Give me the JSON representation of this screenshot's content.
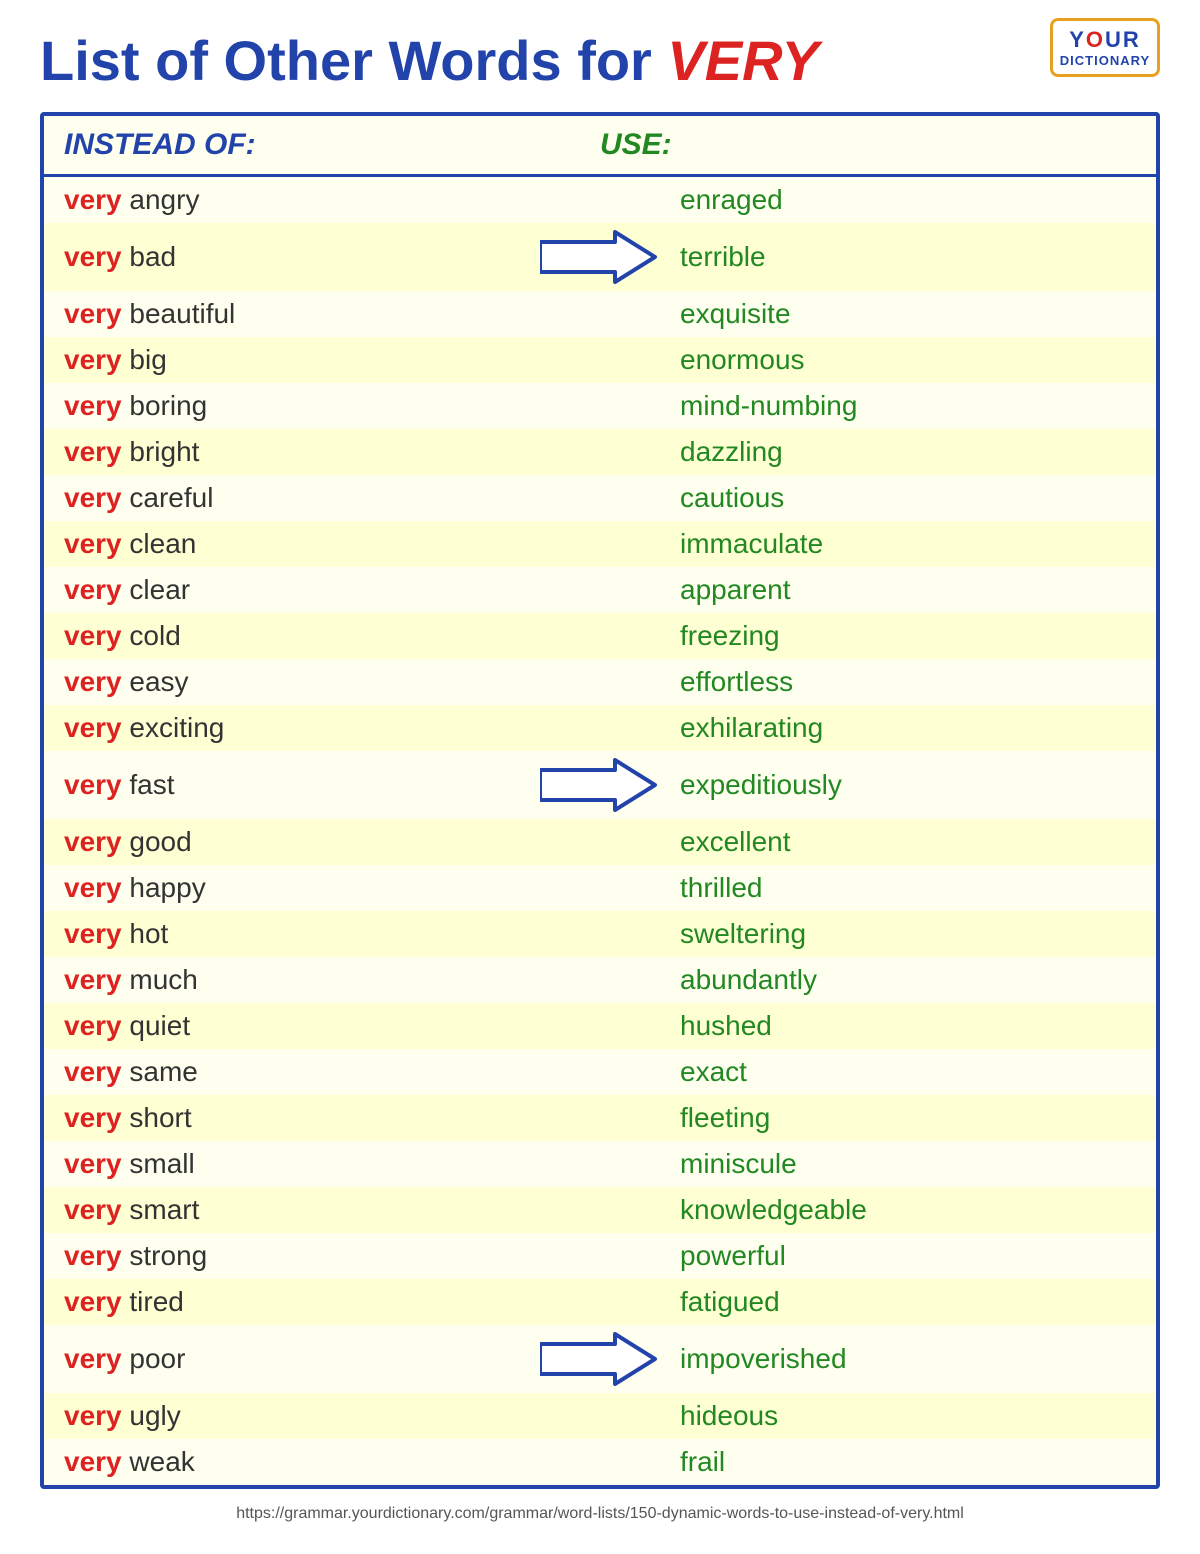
{
  "logo": {
    "your": "Y",
    "your_o": "O",
    "your_u": "U",
    "your_r": "R",
    "dictionary": "DICTIONARY"
  },
  "title": {
    "prefix": "List of Other Words for ",
    "highlight": "VERY"
  },
  "header": {
    "instead_label": "INSTEAD OF:",
    "use_label": "USE:"
  },
  "rows": [
    {
      "very": "very",
      "word": "angry",
      "arrow": false,
      "replacement": "enraged"
    },
    {
      "very": "very",
      "word": "bad",
      "arrow": true,
      "replacement": "terrible"
    },
    {
      "very": "very",
      "word": "beautiful",
      "arrow": false,
      "replacement": "exquisite"
    },
    {
      "very": "very",
      "word": "big",
      "arrow": false,
      "replacement": "enormous"
    },
    {
      "very": "very",
      "word": "boring",
      "arrow": false,
      "replacement": "mind-numbing"
    },
    {
      "very": "very",
      "word": "bright",
      "arrow": false,
      "replacement": "dazzling"
    },
    {
      "very": "very",
      "word": "careful",
      "arrow": false,
      "replacement": "cautious"
    },
    {
      "very": "very",
      "word": "clean",
      "arrow": false,
      "replacement": "immaculate"
    },
    {
      "very": "very",
      "word": "clear",
      "arrow": false,
      "replacement": "apparent"
    },
    {
      "very": "very",
      "word": "cold",
      "arrow": false,
      "replacement": "freezing"
    },
    {
      "very": "very",
      "word": "easy",
      "arrow": false,
      "replacement": "effortless"
    },
    {
      "very": "very",
      "word": "exciting",
      "arrow": false,
      "replacement": "exhilarating"
    },
    {
      "very": "very",
      "word": "fast",
      "arrow": true,
      "replacement": "expeditiously"
    },
    {
      "very": "very",
      "word": "good",
      "arrow": false,
      "replacement": "excellent"
    },
    {
      "very": "very",
      "word": "happy",
      "arrow": false,
      "replacement": "thrilled"
    },
    {
      "very": "very",
      "word": "hot",
      "arrow": false,
      "replacement": "sweltering"
    },
    {
      "very": "very",
      "word": "much",
      "arrow": false,
      "replacement": "abundantly"
    },
    {
      "very": "very",
      "word": "quiet",
      "arrow": false,
      "replacement": "hushed"
    },
    {
      "very": "very",
      "word": "same",
      "arrow": false,
      "replacement": "exact"
    },
    {
      "very": "very",
      "word": "short",
      "arrow": false,
      "replacement": "fleeting"
    },
    {
      "very": "very",
      "word": "small",
      "arrow": false,
      "replacement": "miniscule"
    },
    {
      "very": "very",
      "word": "smart",
      "arrow": false,
      "replacement": "knowledgeable"
    },
    {
      "very": "very",
      "word": "strong",
      "arrow": false,
      "replacement": "powerful"
    },
    {
      "very": "very",
      "word": "tired",
      "arrow": false,
      "replacement": "fatigued"
    },
    {
      "very": "very",
      "word": "poor",
      "arrow": true,
      "replacement": "impoverished"
    },
    {
      "very": "very",
      "word": "ugly",
      "arrow": false,
      "replacement": "hideous"
    },
    {
      "very": "very",
      "word": "weak",
      "arrow": false,
      "replacement": "frail"
    }
  ],
  "footer": {
    "url": "https://grammar.yourdictionary.com/grammar/word-lists/150-dynamic-words-to-use-instead-of-very.html"
  }
}
